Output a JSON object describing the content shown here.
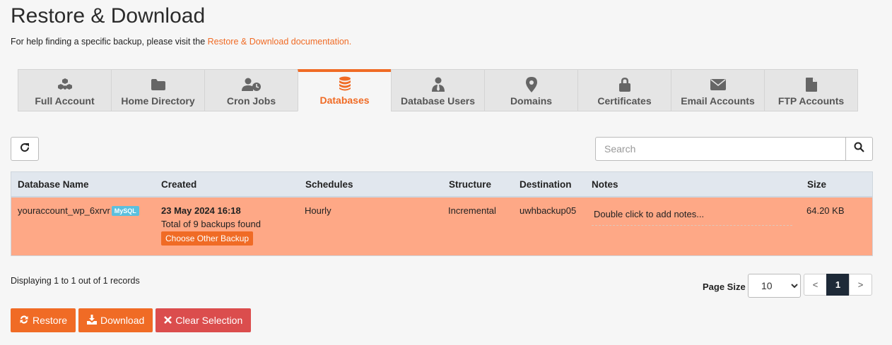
{
  "header": {
    "title": "Restore & Download",
    "help_prefix": "For help finding a specific backup, please visit the ",
    "help_link": "Restore & Download documentation."
  },
  "tabs": [
    {
      "label": "Full Account",
      "icon": "cubes-icon"
    },
    {
      "label": "Home Directory",
      "icon": "folder-icon"
    },
    {
      "label": "Cron Jobs",
      "icon": "user-clock-icon"
    },
    {
      "label": "Databases",
      "icon": "database-icon",
      "active": true
    },
    {
      "label": "Database Users",
      "icon": "user-tie-icon"
    },
    {
      "label": "Domains",
      "icon": "map-marker-icon"
    },
    {
      "label": "Certificates",
      "icon": "lock-icon"
    },
    {
      "label": "Email Accounts",
      "icon": "envelope-icon"
    },
    {
      "label": "FTP Accounts",
      "icon": "file-icon"
    }
  ],
  "search": {
    "placeholder": "Search"
  },
  "table": {
    "columns": [
      "Database Name",
      "Created",
      "Schedules",
      "Structure",
      "Destination",
      "Notes",
      "Size"
    ],
    "rows": [
      {
        "name": "youraccount_wp_6xrvr",
        "badge": "MySQL",
        "created_date": "23 May 2024 16:18",
        "created_count": "Total of 9 backups found",
        "choose_label": "Choose Other Backup",
        "schedule": "Hourly",
        "structure": "Incremental",
        "destination": "uwhbackup05",
        "notes": "Double click to add notes...",
        "size": "64.20 KB"
      }
    ]
  },
  "footer": {
    "records": "Displaying 1 to 1 out of 1 records",
    "page_size_label": "Page Size",
    "page_size": "10",
    "pager": {
      "prev": "<",
      "current": "1",
      "next": ">"
    }
  },
  "actions": {
    "restore": "Restore",
    "download": "Download",
    "clear": "Clear Selection"
  },
  "colors": {
    "accent": "#f06b25",
    "row_selected": "#fea886",
    "danger": "#db4d4d",
    "badge": "#5bc0de"
  }
}
